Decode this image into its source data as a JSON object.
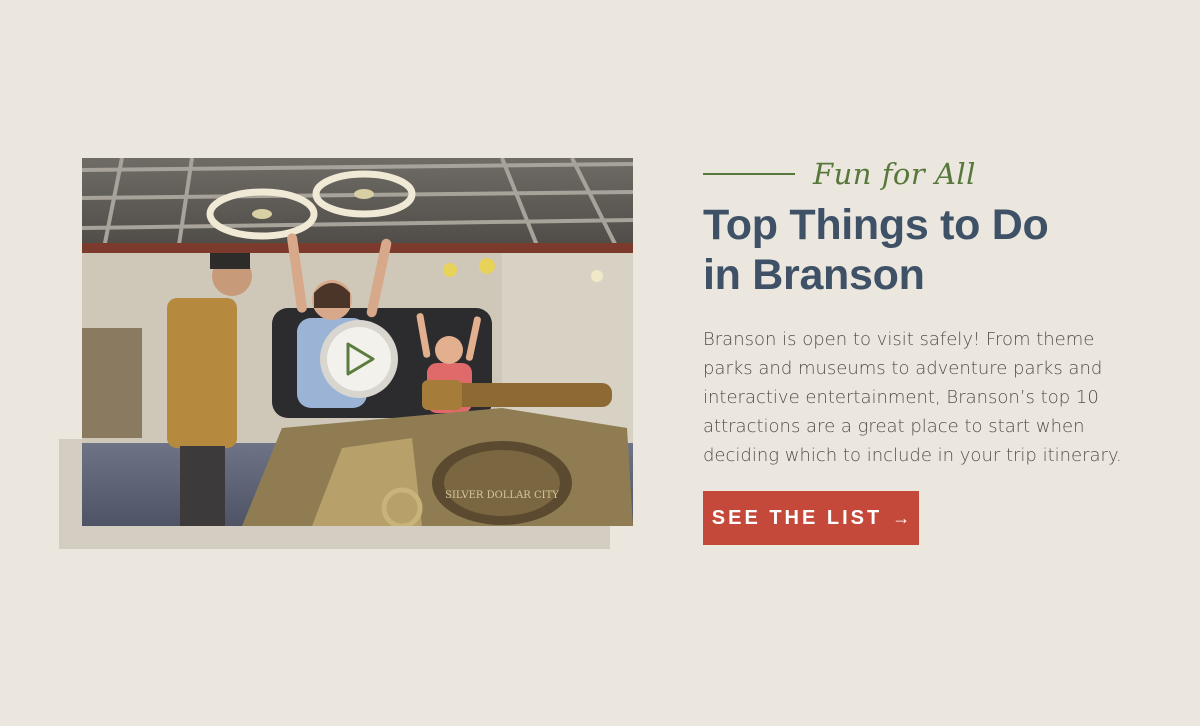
{
  "hero": {
    "eyebrow": "Fun for All",
    "title_line1": "Top Things to Do",
    "title_line2": "in Branson",
    "description": "Branson is open to visit safely! From theme parks and museums to adventure parks and interactive entertainment, Branson’s top 10 attractions are a great place to start when deciding which to include in your trip itinerary.",
    "cta_label": "SEE THE LIST",
    "cta_icon": "arrow-right-icon"
  },
  "video": {
    "play_icon": "play-icon",
    "vehicle_sign": "SILVER DOLLAR CITY"
  },
  "colors": {
    "background": "#ebe6de",
    "accent_green": "#56783a",
    "heading_navy": "#3e5166",
    "cta_red": "#c5493a"
  }
}
